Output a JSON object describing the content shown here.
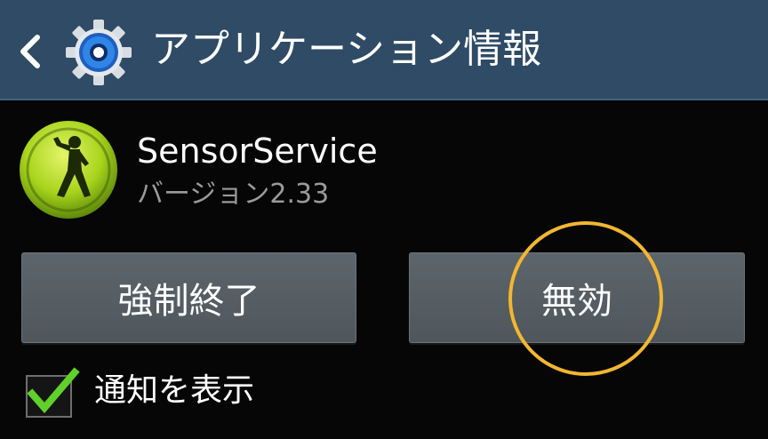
{
  "action_bar": {
    "title": "アプリケーション情報",
    "back_icon": "chevron-left-icon",
    "app_icon": "gear-icon",
    "background_color": "#2f4b66"
  },
  "app": {
    "name": "SensorService",
    "version": "バージョン2.33",
    "icon": "walking-person-icon",
    "icon_color": "#9ccc1a"
  },
  "buttons": {
    "force_stop_label": "強制終了",
    "disable_label": "無効"
  },
  "notification": {
    "label": "通知を表示",
    "checked": true,
    "check_color": "#5fd12a"
  },
  "highlight": {
    "target": "無効",
    "color": "#f2b630"
  }
}
